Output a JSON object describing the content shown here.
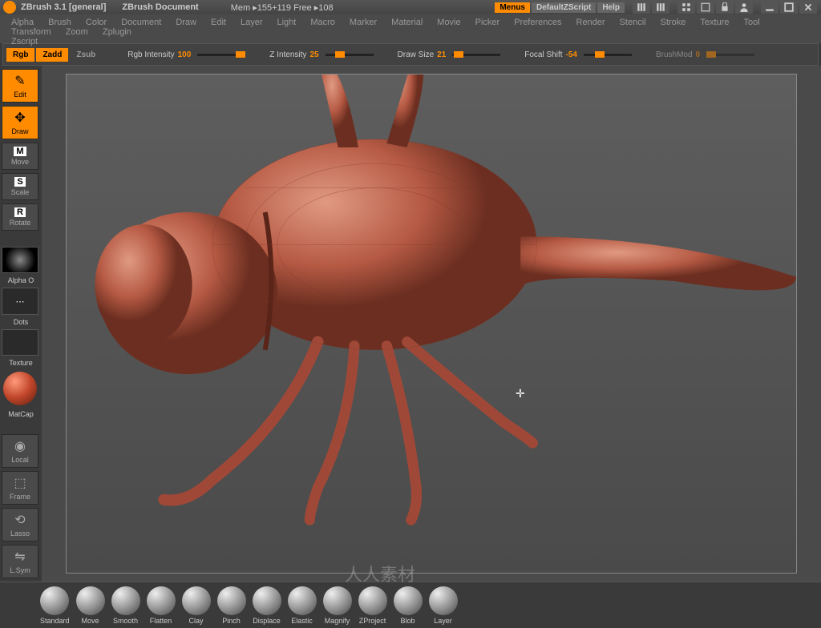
{
  "titlebar": {
    "app": "ZBrush  3.1 [general]",
    "doc": "ZBrush Document",
    "mem": "Mem ▸155+119 Free ▸108",
    "menus": "Menus",
    "script": "DefaultZScript",
    "help": "Help"
  },
  "menus": [
    "Alpha",
    "Brush",
    "Color",
    "Document",
    "Draw",
    "Edit",
    "Layer",
    "Light",
    "Macro",
    "Marker",
    "Material",
    "Movie",
    "Picker",
    "Preferences",
    "Render",
    "Stencil",
    "Stroke",
    "Texture",
    "Tool",
    "Transform",
    "Zoom",
    "Zplugin",
    "Zscript"
  ],
  "toolbar": {
    "rgb": "Rgb",
    "zadd": "Zadd",
    "zsub": "Zsub",
    "rgbi_label": "Rgb Intensity",
    "rgbi_val": "100",
    "zi_label": "Z Intensity",
    "zi_val": "25",
    "ds_label": "Draw Size",
    "ds_val": "21",
    "fs_label": "Focal Shift",
    "fs_val": "-54",
    "bm_label": "BrushMod",
    "bm_val": "0"
  },
  "leftbar": {
    "edit": "Edit",
    "draw": "Draw",
    "move": "Move",
    "scale": "Scale",
    "rotate": "Rotate",
    "alpha": "Alpha O",
    "dots": "Dots",
    "texture": "Texture",
    "matcap": "MatCap",
    "local": "Local",
    "frame": "Frame",
    "lasso": "Lasso",
    "lsym": "L.Sym"
  },
  "brushes": [
    "Standard",
    "Move",
    "Smooth",
    "Flatten",
    "Clay",
    "Pinch",
    "Displace",
    "Elastic",
    "Magnify",
    "ZProject",
    "Blob",
    "Layer"
  ],
  "watermark": "人人素材"
}
